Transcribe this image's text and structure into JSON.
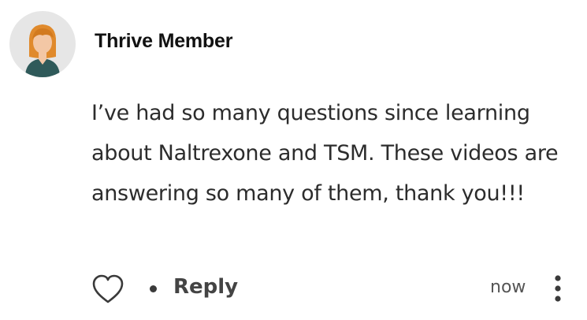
{
  "comment": {
    "author": "Thrive Member",
    "text": "I’ve had so many questions since learning about Naltrexone and TSM. These videos are answering so many of them, thank you!!!",
    "timestamp": "now",
    "reply_label": "Reply",
    "icons": {
      "avatar": "user-avatar-icon",
      "like": "heart-icon",
      "more": "more-vertical-icon"
    }
  },
  "colors": {
    "avatar_bg": "#e6e6e6",
    "hair": "#e08a2c",
    "skin": "#f3c7a5",
    "shirt": "#2f5a5a"
  }
}
